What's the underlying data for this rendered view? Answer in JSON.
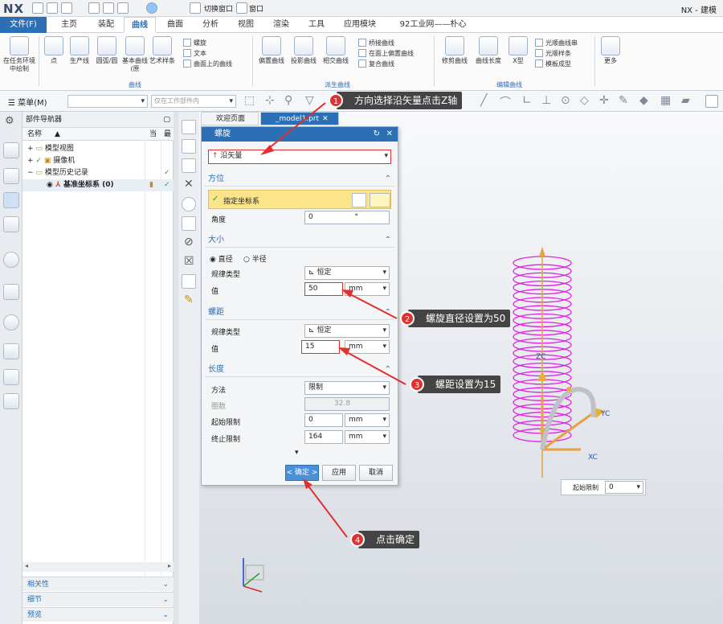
{
  "app": {
    "logo": "NX",
    "title": "NX - 建模",
    "switch_window": "切换窗口",
    "window_menu": "窗口"
  },
  "menu_tabs": [
    "文件(F)",
    "主页",
    "装配",
    "曲线",
    "曲面",
    "分析",
    "视图",
    "渲染",
    "工具",
    "应用模块",
    "92工业网——朴心"
  ],
  "ribbon": {
    "buttons": [
      "在任务环境中绘制",
      "点",
      "生产线",
      "圆弧/圆",
      "基本曲线 (原",
      "艺术样条",
      "偏置曲线",
      "投影曲线",
      "相交曲线",
      "修剪曲线",
      "曲线长度",
      "X型",
      "更多"
    ],
    "small_a": [
      "螺旋",
      "文本",
      "曲面上的曲线"
    ],
    "small_b": [
      "桥接曲线",
      "在面上偏置曲线",
      "复合曲线"
    ],
    "small_c": [
      "光顺曲线串",
      "光顺样条",
      "模板成型"
    ],
    "groups": [
      "曲线",
      "派生曲线",
      "编辑曲线"
    ]
  },
  "toolbar2": {
    "menu": "菜单(M)",
    "filter_placeholder": "仅在工作部件内"
  },
  "navigator": {
    "title": "部件导航器",
    "col_name": "名称",
    "col_current": "当",
    "col_latest": "最",
    "items": [
      "模型视图",
      "摄像机",
      "模型历史记录",
      "基准坐标系 (0)"
    ],
    "footer": [
      "相关性",
      "细节",
      "预览"
    ]
  },
  "graphics": {
    "tabs": [
      "欢迎页面",
      "_model1.prt"
    ],
    "start_limit_label": "起始限制",
    "start_limit_value": "0"
  },
  "dialog": {
    "title": "螺旋",
    "type_value": "沿矢量",
    "orient_title": "方位",
    "specify_csys": "指定坐标系",
    "angle_label": "角度",
    "angle_value": "0",
    "angle_unit": "°",
    "size_title": "大小",
    "diameter": "直径",
    "radius": "半径",
    "law_label": "规律类型",
    "law_value": "恒定",
    "value_label": "值",
    "size_value": "50",
    "unit": "mm",
    "pitch_title": "螺距",
    "pitch_value": "15",
    "length_title": "长度",
    "method_label": "方法",
    "method_value": "限制",
    "turns_label": "圈数",
    "turns_value": "32.8",
    "start_label": "起始限制",
    "start_value": "0",
    "end_label": "终止限制",
    "end_value": "164",
    "ok": "< 确定 >",
    "apply": "应用",
    "cancel": "取消"
  },
  "callouts": [
    {
      "n": "1",
      "text": "方向选择沿矢量点击Z轴"
    },
    {
      "n": "2",
      "text": "螺旋直径设置为50"
    },
    {
      "n": "3",
      "text": "螺距设置为15"
    },
    {
      "n": "4",
      "text": "点击确定"
    }
  ],
  "axis_labels": {
    "z": "ZC",
    "y": "YC",
    "x": "XC"
  },
  "colors": {
    "accent": "#2c6fb5",
    "helix": "#e020e0",
    "callout_bg": "#444444",
    "marker": "#e0302f",
    "check": "#2aa02a"
  }
}
